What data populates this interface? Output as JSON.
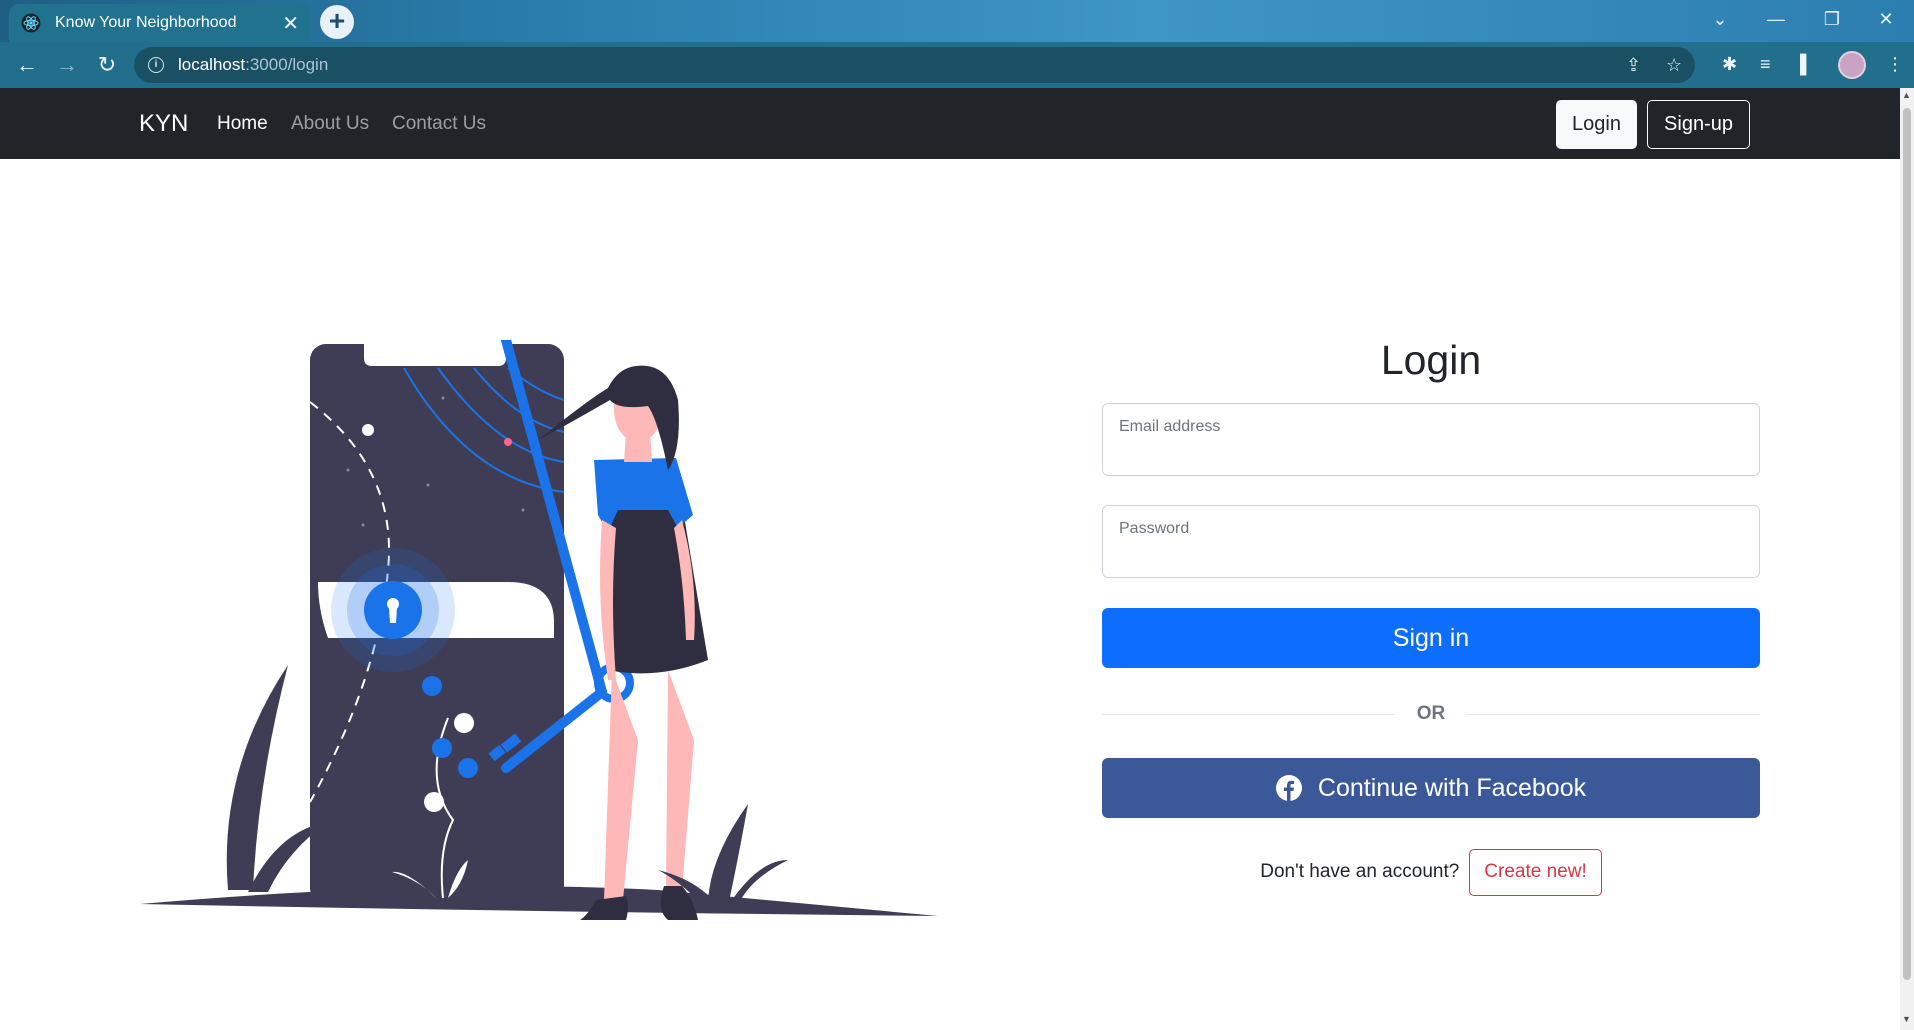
{
  "browser": {
    "tab_title": "Know Your Neighborhood",
    "tab_close": "✕",
    "new_tab": "+",
    "url_host": "localhost",
    "url_path": ":3000/login"
  },
  "navbar": {
    "brand": "KYN",
    "links": [
      "Home",
      "About Us",
      "Contact Us"
    ],
    "login_button": "Login",
    "signup_button": "Sign-up"
  },
  "login_form": {
    "title": "Login",
    "email_label": "Email address",
    "email_value": "",
    "password_label": "Password",
    "password_value": "",
    "signin_button": "Sign in",
    "divider_text": "OR",
    "facebook_button": "Continue with Facebook",
    "signup_prompt": "Don't have an account?",
    "create_button": "Create new!"
  },
  "colors": {
    "primary": "#0d6efd",
    "facebook": "#3b5998",
    "danger": "#dc3545",
    "navbar_bg": "#212529",
    "illustration_dark": "#3f3d56",
    "illustration_accent": "#1a73e8"
  }
}
